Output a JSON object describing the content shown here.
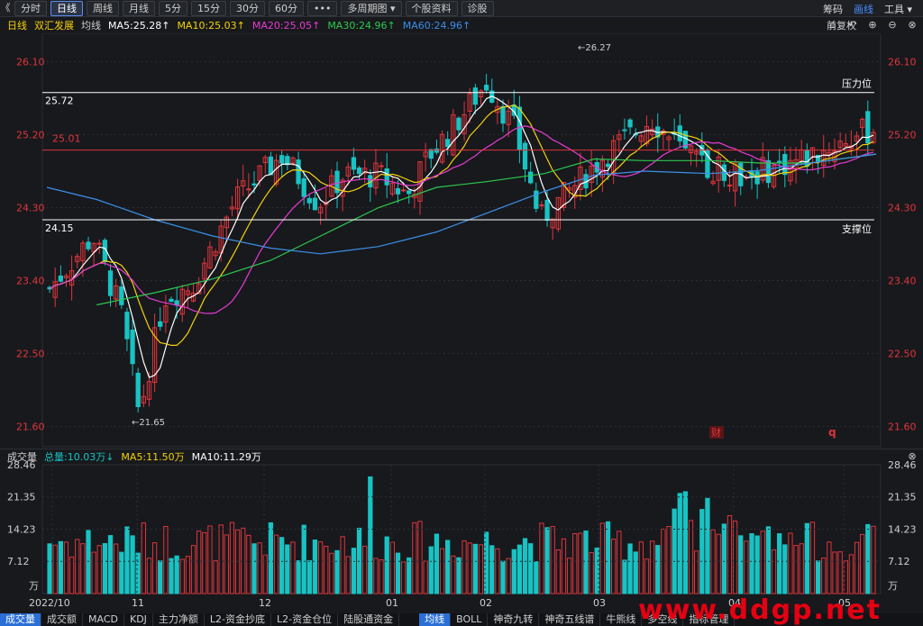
{
  "toolbar": {
    "back_glyph": "《",
    "periods": [
      "分时",
      "日线",
      "周线",
      "月线",
      "5分",
      "15分",
      "30分",
      "60分"
    ],
    "active_period": "日线",
    "more_label": "•••",
    "multi_period_label": "多周期图 ▾",
    "stock_info_label": "个股资料",
    "diagnose_label": "诊股",
    "right": {
      "chips": "筹码",
      "draw": "画线",
      "tools": "工具 ▾"
    }
  },
  "infobar": {
    "period": "日线",
    "stock_name": "双汇发展",
    "avg_label": "均线",
    "ma5": "MA5:25.28↑",
    "ma10": "MA10:25.03↑",
    "ma20": "MA20:25.05↑",
    "ma30": "MA30:24.96↑",
    "ma60": "MA60:24.96↑",
    "adjust": "前复权",
    "icons": [
      "lock-icon",
      "undo-icon",
      "plus-icon",
      "minus-icon",
      "close-icon"
    ]
  },
  "colors": {
    "up": "#e0353b",
    "down": "#18c3c3",
    "ma5": "#ffffff",
    "ma10": "#f5d10a",
    "ma20": "#e83bd1",
    "ma30": "#2ec84e",
    "ma60": "#3d8fe8",
    "bg": "#17191d",
    "grid": "#2a2d33",
    "axis_text": "#e0353b"
  },
  "chart_data": {
    "type": "candlestick",
    "price_axis_ticks": [
      26.1,
      25.2,
      24.3,
      23.4,
      22.5,
      21.6
    ],
    "price_axis_labels": [
      "26.10",
      "25.20",
      "24.30",
      "23.40",
      "22.50",
      "21.60"
    ],
    "ylim": [
      21.35,
      26.45
    ],
    "annotations": {
      "high": "←26.27",
      "low": "←21.65",
      "high_value": 26.27,
      "low_value": 21.65
    },
    "lines": [
      {
        "value": 25.72,
        "label_left": "25.72",
        "label_right": "压力位",
        "color": "#ffffff"
      },
      {
        "value": 25.01,
        "label_left": "25.01",
        "label_right": "",
        "color": "#e0353b"
      },
      {
        "value": 24.15,
        "label_left": "24.15",
        "label_right": "支撑位",
        "color": "#ffffff"
      }
    ],
    "markers": {
      "fin": "财",
      "q": "q"
    },
    "x_axis_labels": [
      "2022/10",
      "11",
      "12",
      "01",
      "02",
      "03",
      "04",
      "05"
    ],
    "ma_legend": [
      "MA5",
      "MA10",
      "MA20",
      "MA30",
      "MA60"
    ],
    "series_points": {
      "ma60": [
        [
          0,
          24.55
        ],
        [
          0.06,
          24.4
        ],
        [
          0.13,
          24.15
        ],
        [
          0.2,
          23.95
        ],
        [
          0.27,
          23.8
        ],
        [
          0.33,
          23.73
        ],
        [
          0.4,
          23.82
        ],
        [
          0.47,
          24.0
        ],
        [
          0.53,
          24.23
        ],
        [
          0.6,
          24.5
        ],
        [
          0.66,
          24.7
        ],
        [
          0.72,
          24.75
        ],
        [
          0.8,
          24.72
        ],
        [
          0.86,
          24.76
        ],
        [
          0.92,
          24.85
        ],
        [
          1,
          24.96
        ]
      ],
      "ma30": [
        [
          0.06,
          23.1
        ],
        [
          0.13,
          23.25
        ],
        [
          0.2,
          23.42
        ],
        [
          0.27,
          23.65
        ],
        [
          0.33,
          23.95
        ],
        [
          0.4,
          24.3
        ],
        [
          0.47,
          24.55
        ],
        [
          0.53,
          24.62
        ],
        [
          0.6,
          24.72
        ],
        [
          0.66,
          24.9
        ],
        [
          0.72,
          24.88
        ],
        [
          0.8,
          24.88
        ],
        [
          0.86,
          24.85
        ],
        [
          0.92,
          24.85
        ],
        [
          1,
          24.96
        ]
      ]
    }
  },
  "volume": {
    "title": "成交量",
    "total": "总量:10.03万↓",
    "ma5": "MA5:11.50万",
    "ma10": "MA10:11.29万",
    "axis_ticks": [
      28.46,
      21.35,
      14.23,
      7.12
    ],
    "axis_labels": [
      "28.46",
      "21.35",
      "14.23",
      "7.12"
    ],
    "unit": "万",
    "ylim": [
      0,
      28.46
    ]
  },
  "bottom_tabs": [
    "成交量",
    "成交额",
    "MACD",
    "KDJ",
    "主力净额",
    "L2-资金抄底",
    "L2-资金仓位",
    "陆股通资金",
    "均线",
    "BOLL",
    "神奇九转",
    "神奇五线谱",
    "牛熊线",
    "多空线",
    "指标管理"
  ],
  "selected_tabs": [
    "成交量",
    "均线"
  ],
  "watermark": "www.ddgp.net"
}
